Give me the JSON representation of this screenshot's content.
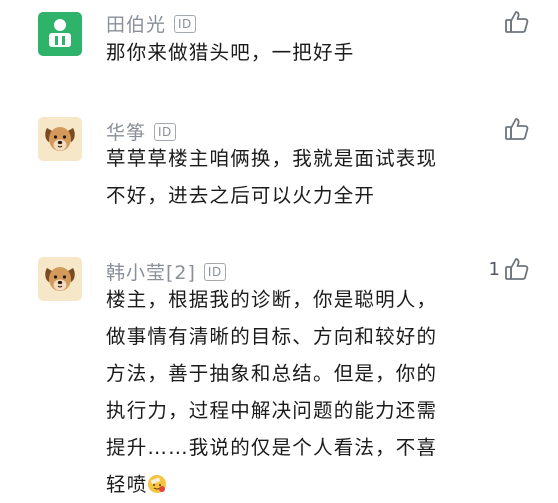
{
  "comments": [
    {
      "name": "田伯光",
      "badge": "ID",
      "text": "那你来做猎头吧，一把好手",
      "likes": "",
      "avatar_icon": "green-person-avatar-icon"
    },
    {
      "name": "华筝",
      "badge": "ID",
      "text": "草草草楼主咱俩换，我就是面试表现不好，进去之后可以火力全开",
      "likes": "",
      "avatar_icon": "dog-avatar-icon"
    },
    {
      "name": "韩小莹[2]",
      "badge": "ID",
      "text": "楼主，根据我的诊断，你是聪明人，做事情有清晰的目标、方向和较好的方法，善于抽象和总结。但是，你的执行力，过程中解决问题的能力还需提升……我说的仅是个人看法，不喜轻喷",
      "likes": "1",
      "avatar_icon": "dog-avatar-icon",
      "trailing_emoji": "bandaged-face-emoji"
    }
  ],
  "colors": {
    "name": "#8a9099",
    "text": "#1b1b1b",
    "avatar_green": "#2fb36a",
    "avatar_dog_bg": "#f6e7c9"
  }
}
